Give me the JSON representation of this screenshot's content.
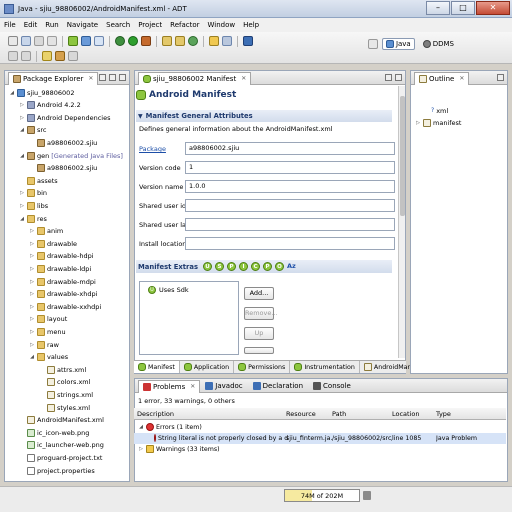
{
  "window": {
    "title": "Java - sjiu_98806002/AndroidManifest.xml - ADT",
    "minimize": "–",
    "maximize": "□",
    "close": "✕"
  },
  "menu": [
    "File",
    "Edit",
    "Run",
    "Navigate",
    "Search",
    "Project",
    "Refactor",
    "Window",
    "Help"
  ],
  "perspectives": {
    "java": "Java",
    "ddms": "DDMS"
  },
  "package_explorer": {
    "tab_label": "Package Explorer",
    "tree": [
      {
        "label": "sjiu_98806002",
        "icon": "project-icon",
        "twisty": "◢"
      },
      {
        "label": "Android 4.2.2",
        "icon": "library-icon",
        "twisty": "▷"
      },
      {
        "label": "Android Dependencies",
        "icon": "library-icon",
        "twisty": "▷"
      },
      {
        "label": "src",
        "icon": "package-folder-icon",
        "twisty": "◢"
      },
      {
        "label": "a98806002.sjiu",
        "icon": "package-icon",
        "twisty": ""
      },
      {
        "label": "gen",
        "suffix": "[Generated Java Files]",
        "icon": "package-folder-icon",
        "twisty": "◢"
      },
      {
        "label": "a98806002.sjiu",
        "icon": "package-icon",
        "twisty": ""
      },
      {
        "label": "assets",
        "icon": "folder-icon",
        "twisty": ""
      },
      {
        "label": "bin",
        "icon": "folder-icon",
        "twisty": "▷"
      },
      {
        "label": "libs",
        "icon": "folder-icon",
        "twisty": "▷"
      },
      {
        "label": "res",
        "icon": "folder-icon",
        "twisty": "◢"
      },
      {
        "label": "anim",
        "icon": "folder-icon",
        "twisty": "▷"
      },
      {
        "label": "drawable",
        "icon": "folder-icon",
        "twisty": "▷"
      },
      {
        "label": "drawable-hdpi",
        "icon": "folder-icon",
        "twisty": "▷"
      },
      {
        "label": "drawable-ldpi",
        "icon": "folder-icon",
        "twisty": "▷"
      },
      {
        "label": "drawable-mdpi",
        "icon": "folder-icon",
        "twisty": "▷"
      },
      {
        "label": "drawable-xhdpi",
        "icon": "folder-icon",
        "twisty": "▷"
      },
      {
        "label": "drawable-xxhdpi",
        "icon": "folder-icon",
        "twisty": "▷"
      },
      {
        "label": "layout",
        "icon": "folder-icon",
        "twisty": "▷"
      },
      {
        "label": "menu",
        "icon": "folder-icon",
        "twisty": "▷"
      },
      {
        "label": "raw",
        "icon": "folder-icon",
        "twisty": "▷"
      },
      {
        "label": "values",
        "icon": "folder-icon",
        "twisty": "◢"
      },
      {
        "label": "attrs.xml",
        "icon": "xml-file-icon",
        "twisty": ""
      },
      {
        "label": "colors.xml",
        "icon": "xml-file-icon",
        "twisty": ""
      },
      {
        "label": "strings.xml",
        "icon": "xml-file-icon",
        "twisty": ""
      },
      {
        "label": "styles.xml",
        "icon": "xml-file-icon",
        "twisty": ""
      },
      {
        "label": "AndroidManifest.xml",
        "icon": "xml-file-icon",
        "twisty": ""
      },
      {
        "label": "ic_icon-web.png",
        "icon": "image-file-icon",
        "twisty": ""
      },
      {
        "label": "ic_launcher-web.png",
        "icon": "image-file-icon",
        "twisty": ""
      },
      {
        "label": "proguard-project.txt",
        "icon": "text-file-icon",
        "twisty": ""
      },
      {
        "label": "project.properties",
        "icon": "text-file-icon",
        "twisty": ""
      }
    ]
  },
  "editor": {
    "tab_label": "sjiu_98806002 Manifest",
    "page_title": "Android Manifest",
    "section_title": "Manifest General Attributes",
    "section_desc": "Defines general information about the AndroidManifest.xml",
    "fields": [
      {
        "label": "Package",
        "value": "a98806002.sjiu",
        "link": true
      },
      {
        "label": "Version code",
        "value": "1",
        "link": false
      },
      {
        "label": "Version name",
        "value": "1.0.0",
        "link": false
      },
      {
        "label": "Shared user id",
        "value": "",
        "link": false
      },
      {
        "label": "Shared user label",
        "value": "",
        "link": false
      },
      {
        "label": "Install location",
        "value": "",
        "link": false
      }
    ],
    "extras_title": "Manifest Extras",
    "extras_chips": [
      "U",
      "S",
      "P",
      "I",
      "C",
      "P",
      "O",
      "Az"
    ],
    "extras_items": [
      "Uses Sdk"
    ],
    "buttons": {
      "add": "Add...",
      "remove": "Remove...",
      "up": "Up"
    },
    "bottom_tabs": [
      "Manifest",
      "Application",
      "Permissions",
      "Instrumentation",
      "AndroidManifest.xml"
    ]
  },
  "outline": {
    "tab_label": "Outline",
    "items": [
      {
        "label": "xml",
        "prefix": "?"
      },
      {
        "label": "manifest",
        "prefix": ""
      }
    ]
  },
  "problems": {
    "tabs": [
      "Problems",
      "Javadoc",
      "Declaration",
      "Console"
    ],
    "summary": "1 error, 33 warnings, 0 others",
    "columns": [
      "Description",
      "Resource",
      "Path",
      "Location",
      "Type"
    ],
    "rows": [
      {
        "description": "Errors (1 item)",
        "resource": "",
        "path": "",
        "location": "",
        "type": "",
        "kind": "group-error"
      },
      {
        "description": "String literal is not properly closed by a doubl",
        "resource": "sjiu_finterm.ja...",
        "path": "/sjiu_98806002/src/...",
        "location": "line 1085",
        "type": "Java Problem",
        "kind": "error"
      },
      {
        "description": "Warnings (33 items)",
        "resource": "",
        "path": "",
        "location": "",
        "type": "",
        "kind": "group-warning"
      }
    ]
  },
  "status": {
    "heap": "74M of 202M",
    "heap_used_fraction": 0.366
  }
}
